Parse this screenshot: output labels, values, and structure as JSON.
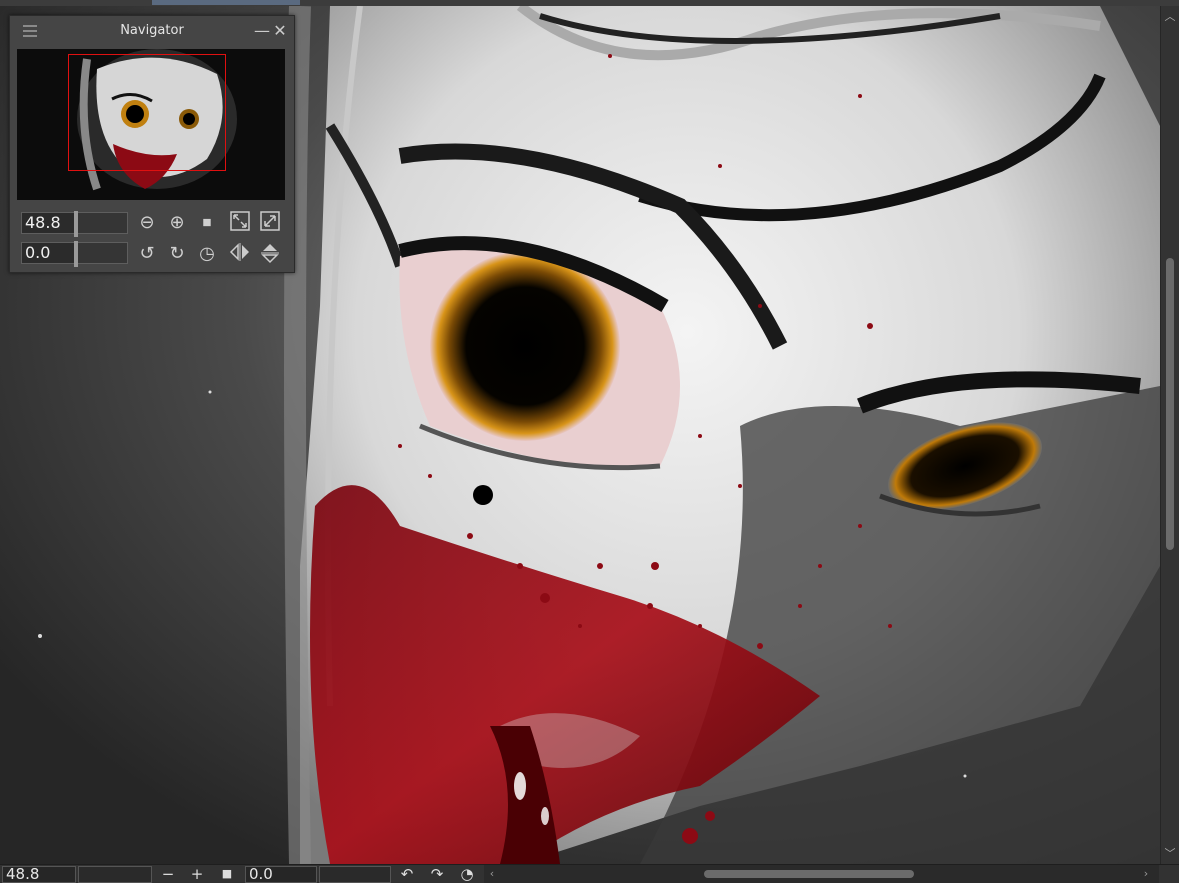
{
  "navigator": {
    "title": "Navigator",
    "zoom_value": "48.8",
    "rotation_value": "0.0",
    "frame_color": "#e01010",
    "icons": {
      "menu": "hamburger-icon",
      "minimize": "minimize-icon",
      "close": "close-icon",
      "zoom_out": "zoom-out-icon",
      "zoom_in": "zoom-in-icon",
      "actual_size": "stop-square-icon",
      "fit_to_window": "fit-window-icon",
      "fit_to_screen": "expand-icon",
      "rotate_left": "rotate-left-icon",
      "rotate_right": "rotate-right-icon",
      "reset_rotation": "reset-rotation-icon",
      "flip_horizontal": "flip-horizontal-icon",
      "flip_vertical": "flip-vertical-icon"
    }
  },
  "statusbar": {
    "zoom_value": "48.8",
    "rotation_value": "0.0",
    "zoom_out_glyph": "−",
    "zoom_in_glyph": "+",
    "actual_size_glyph": "■",
    "rotate_left_glyph": "↶",
    "rotate_right_glyph": "↷",
    "reset_glyph": "◔",
    "scroll_left_glyph": "‹",
    "scroll_right_glyph": "›",
    "scroll_up_glyph": "︿",
    "scroll_down_glyph": "﹀"
  },
  "glyphs": {
    "minimize": "—",
    "close": "✕",
    "zoom_out": "⊖",
    "zoom_in": "⊕",
    "actual_size": "⏹",
    "rotate_left": "↺",
    "rotate_right": "↻",
    "reset_rotation": "◷",
    "flip_horizontal": "◧",
    "flip_vertical": "⏚"
  },
  "colors": {
    "blood": "#8c0a14",
    "iris": "#d08a10",
    "skin": "#e6e6e6",
    "panel": "#454545"
  }
}
